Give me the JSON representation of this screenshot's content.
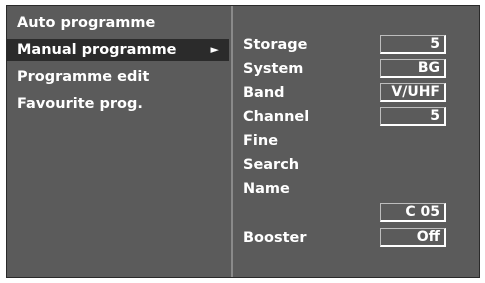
{
  "menu": {
    "items": [
      {
        "label": "Auto programme"
      },
      {
        "label": "Manual programme",
        "arrow": "►"
      },
      {
        "label": "Programme edit"
      },
      {
        "label": "Favourite prog."
      }
    ]
  },
  "settings": {
    "storage": {
      "label": "Storage",
      "value": "5"
    },
    "system": {
      "label": "System",
      "value": "BG"
    },
    "band": {
      "label": "Band",
      "value": "V/UHF"
    },
    "channel": {
      "label": "Channel",
      "value": "5"
    },
    "fine": {
      "label": "Fine"
    },
    "search": {
      "label": "Search"
    },
    "name": {
      "label": "Name",
      "value": "C 05"
    },
    "booster": {
      "label": "Booster",
      "value": "Off"
    }
  }
}
